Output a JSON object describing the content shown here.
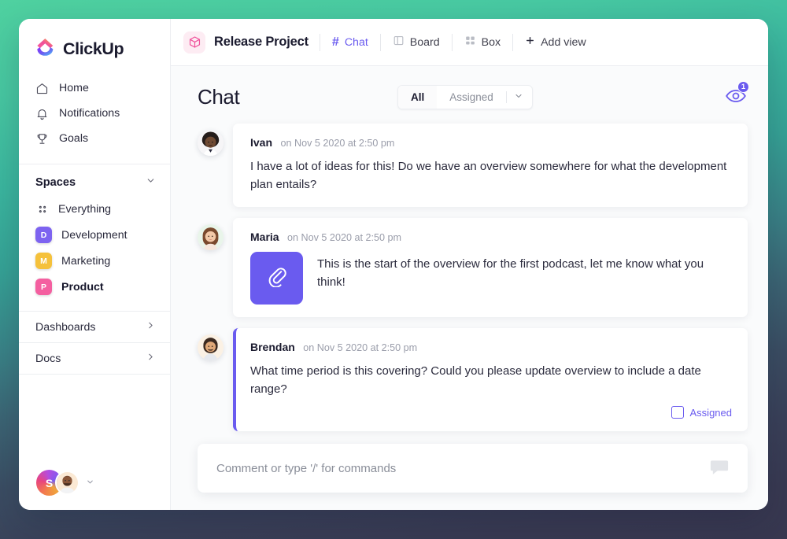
{
  "theme": {
    "accent_purple": "#6a5bef",
    "bg_gradient_top": "#4fd1a0",
    "bg_gradient_bottom": "#383850",
    "pink": "#f0539c"
  },
  "sidebar": {
    "brand": {
      "name": "ClickUp",
      "logo_icon": "clickup-logo-icon"
    },
    "nav": [
      {
        "label": "Home",
        "icon": "home-icon"
      },
      {
        "label": "Notifications",
        "icon": "bell-icon"
      },
      {
        "label": "Goals",
        "icon": "trophy-icon"
      }
    ],
    "spaces_section": {
      "title": "Spaces",
      "chevron_icon": "chevron-down-icon",
      "items": [
        {
          "label": "Everything",
          "icon": "grid-dots-icon",
          "badge": null,
          "color": null,
          "active": false
        },
        {
          "label": "Development",
          "icon": null,
          "badge": "D",
          "color": "#7d63f0",
          "active": false
        },
        {
          "label": "Marketing",
          "icon": null,
          "badge": "M",
          "color": "#f5c13b",
          "active": false
        },
        {
          "label": "Product",
          "icon": null,
          "badge": "P",
          "color": "#f45fa0",
          "active": true
        }
      ]
    },
    "lists": [
      {
        "label": "Dashboards",
        "chevron_icon": "chevron-right-icon"
      },
      {
        "label": "Docs",
        "chevron_icon": "chevron-right-icon"
      }
    ],
    "footer": {
      "workspace_initial": "S",
      "workspace_avatar": "workspace-avatar",
      "user_avatar": "user-avatar",
      "chevron_icon": "chevron-down-icon"
    }
  },
  "topbar": {
    "project_icon": "cube-icon",
    "project_title": "Release Project",
    "views": [
      {
        "label": "Chat",
        "icon": "hash-icon",
        "active": true
      },
      {
        "label": "Board",
        "icon": "board-icon",
        "active": false
      },
      {
        "label": "Box",
        "icon": "box-grid-icon",
        "active": false
      }
    ],
    "add_view": {
      "label": "Add view",
      "icon": "plus-icon"
    }
  },
  "chat": {
    "title": "Chat",
    "filter": {
      "all_label": "All",
      "assigned_label": "Assigned",
      "selected": "All",
      "caret_icon": "chevron-down-icon"
    },
    "watchers": {
      "icon": "eye-icon",
      "count": "1"
    },
    "messages": [
      {
        "author": "Ivan",
        "time": "on Nov 5 2020 at 2:50 pm",
        "text": "I have a lot of ideas for this! Do we have an overview somewhere for what the development plan entails?",
        "avatar": "avatar-ivan",
        "highlighted": false,
        "attachment": null,
        "assigned": null
      },
      {
        "author": "Maria",
        "time": "on Nov 5 2020 at 2:50 pm",
        "text": "This is the start of the overview for the first podcast, let me know what you think!",
        "avatar": "avatar-maria",
        "highlighted": false,
        "attachment": {
          "icon": "paperclip-icon",
          "color": "#6a5bef"
        },
        "assigned": null
      },
      {
        "author": "Brendan",
        "time": "on Nov 5 2020 at 2:50 pm",
        "text": "What time period is this covering? Could you please update overview to include a date range?",
        "avatar": "avatar-brendan",
        "highlighted": true,
        "attachment": null,
        "assigned": {
          "label": "Assigned",
          "checked": false
        }
      }
    ],
    "composer": {
      "placeholder": "Comment or type '/' for commands",
      "value": "",
      "action_icon": "comment-bubble-icon"
    }
  }
}
